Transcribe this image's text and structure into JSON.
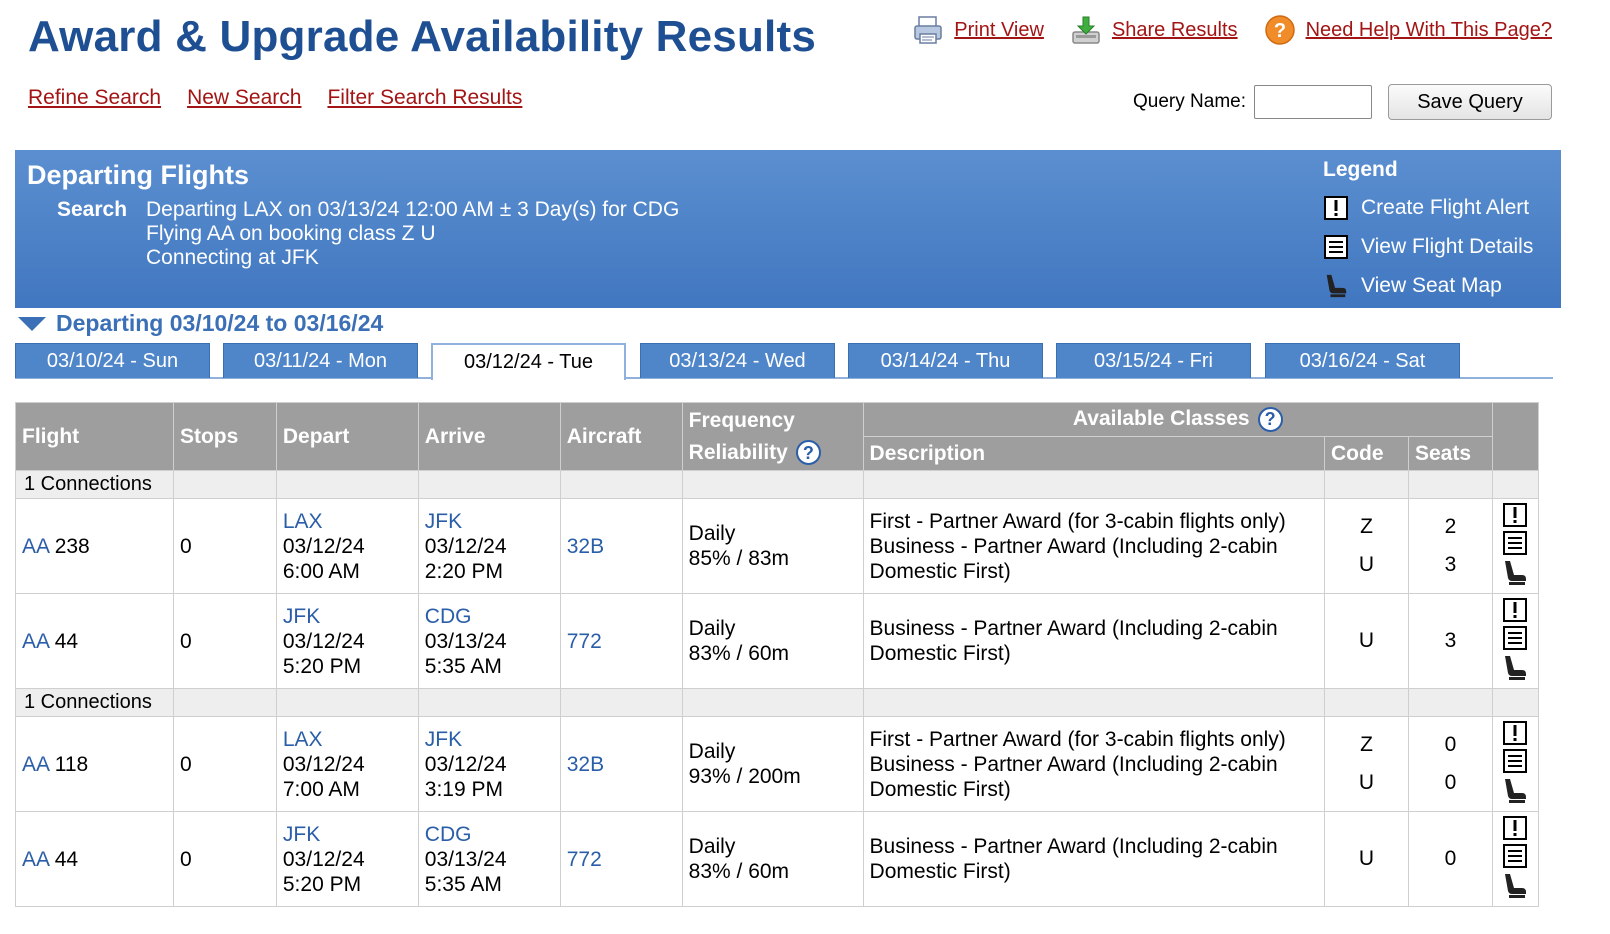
{
  "header": {
    "title": "Award & Upgrade Availability Results",
    "print_view": "Print View",
    "share_results": "Share Results",
    "need_help": "Need Help With This Page?",
    "refine_search": "Refine Search",
    "new_search": "New Search",
    "filter_results": "Filter Search Results",
    "query_label": "Query Name:",
    "query_value": "",
    "save_query": "Save Query"
  },
  "banner": {
    "title": "Departing Flights",
    "search_label": "Search",
    "line1": "Departing LAX on 03/13/24 12:00 AM ± 3 Day(s) for CDG",
    "line2": "Flying AA on booking class Z U",
    "line3": "Connecting at JFK",
    "legend_title": "Legend",
    "legend_alert": "Create Flight Alert",
    "legend_details": "View Flight Details",
    "legend_seat": "View Seat Map"
  },
  "date_range": "Departing 03/10/24 to 03/16/24",
  "tabs": [
    "03/10/24 - Sun",
    "03/11/24 - Mon",
    "03/12/24 - Tue",
    "03/13/24 - Wed",
    "03/14/24 - Thu",
    "03/15/24 - Fri",
    "03/16/24 - Sat"
  ],
  "active_tab": "03/12/24 - Tue",
  "table": {
    "headers": {
      "flight": "Flight",
      "stops": "Stops",
      "depart": "Depart",
      "arrive": "Arrive",
      "aircraft": "Aircraft",
      "freq1": "Frequency",
      "freq2": "Reliability",
      "available_classes": "Available Classes",
      "description": "Description",
      "code": "Code",
      "seats": "Seats"
    },
    "groups": [
      {
        "label": "1 Connections",
        "flights": [
          {
            "airline": "AA",
            "number": "238",
            "stops": "0",
            "dep_airport": "LAX",
            "dep_date": "03/12/24",
            "dep_time": "6:00 AM",
            "arr_airport": "JFK",
            "arr_date": "03/12/24",
            "arr_time": "2:20 PM",
            "aircraft": "32B",
            "frequency": "Daily",
            "reliability": "85% / 83m",
            "classes": [
              {
                "desc": "First - Partner Award (for 3-cabin flights only)",
                "code": "Z",
                "seats": "2"
              },
              {
                "desc": "Business - Partner Award (Including 2-cabin Domestic First)",
                "code": "U",
                "seats": "3"
              }
            ]
          },
          {
            "airline": "AA",
            "number": "44",
            "stops": "0",
            "dep_airport": "JFK",
            "dep_date": "03/12/24",
            "dep_time": "5:20 PM",
            "arr_airport": "CDG",
            "arr_date": "03/13/24",
            "arr_time": "5:35 AM",
            "aircraft": "772",
            "frequency": "Daily",
            "reliability": "83% / 60m",
            "classes": [
              {
                "desc": "Business - Partner Award (Including 2-cabin Domestic First)",
                "code": "U",
                "seats": "3"
              }
            ]
          }
        ]
      },
      {
        "label": "1 Connections",
        "flights": [
          {
            "airline": "AA",
            "number": "118",
            "stops": "0",
            "dep_airport": "LAX",
            "dep_date": "03/12/24",
            "dep_time": "7:00 AM",
            "arr_airport": "JFK",
            "arr_date": "03/12/24",
            "arr_time": "3:19 PM",
            "aircraft": "32B",
            "frequency": "Daily",
            "reliability": "93% / 200m",
            "classes": [
              {
                "desc": "First - Partner Award (for 3-cabin flights only)",
                "code": "Z",
                "seats": "0"
              },
              {
                "desc": "Business - Partner Award (Including 2-cabin Domestic First)",
                "code": "U",
                "seats": "0"
              }
            ]
          },
          {
            "airline": "AA",
            "number": "44",
            "stops": "0",
            "dep_airport": "JFK",
            "dep_date": "03/12/24",
            "dep_time": "5:20 PM",
            "arr_airport": "CDG",
            "arr_date": "03/13/24",
            "arr_time": "5:35 AM",
            "aircraft": "772",
            "frequency": "Daily",
            "reliability": "83% / 60m",
            "classes": [
              {
                "desc": "Business - Partner Award (Including 2-cabin Domestic First)",
                "code": "U",
                "seats": "0"
              }
            ]
          }
        ]
      }
    ]
  },
  "colors": {
    "title_blue": "#1f4f93",
    "link_red": "#a31515",
    "banner_blue": "#4f85c9",
    "header_gray": "#9e9e9e",
    "value_blue": "#2a5ea8"
  },
  "icons": [
    "print-icon",
    "share-icon",
    "help-icon",
    "flight-alert-icon",
    "flight-details-icon",
    "seat-map-icon"
  ]
}
